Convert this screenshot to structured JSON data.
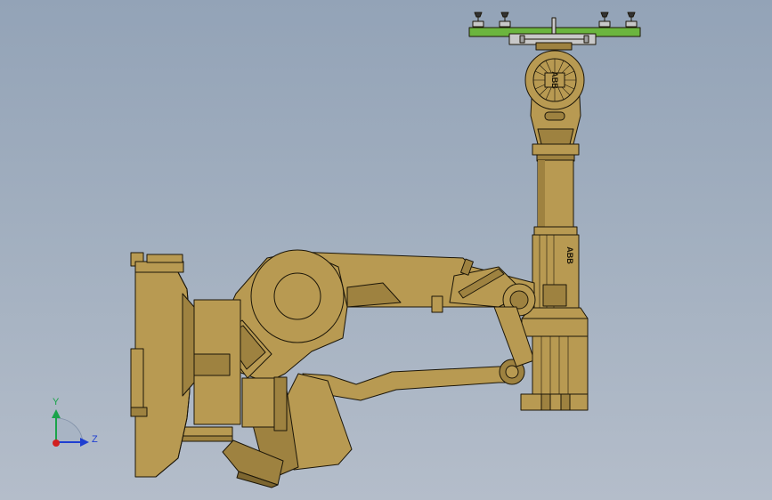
{
  "triad": {
    "y_label": "Y",
    "z_label": "Z",
    "colors": {
      "y": "#1aa34a",
      "z": "#1f3fd1",
      "x": "#d11f1f"
    }
  },
  "robot": {
    "brand_front": "ABB",
    "brand_side": "ABB",
    "colors": {
      "body": "#b89a52",
      "shade": "#9e8240",
      "dark": "#7d6630",
      "outline": "#1c1608",
      "tool_plate": "#6bb53e",
      "tool_frame": "#c8c8c8"
    }
  }
}
